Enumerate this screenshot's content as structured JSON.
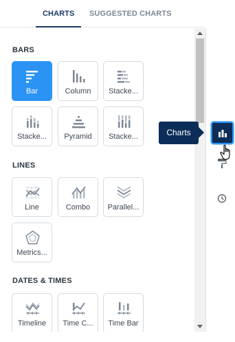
{
  "tabs": [
    {
      "label": "CHARTS",
      "active": true
    },
    {
      "label": "SUGGESTED CHARTS",
      "active": false
    }
  ],
  "sections": {
    "bars": {
      "title": "BARS",
      "items": [
        {
          "label": "Bar",
          "icon": "bar-chart-icon",
          "selected": true
        },
        {
          "label": "Column",
          "icon": "column-chart-icon"
        },
        {
          "label": "Stacke...",
          "icon": "stacked-bar-icon"
        },
        {
          "label": "Stacke...",
          "icon": "stacked-column-icon"
        },
        {
          "label": "Pyramid",
          "icon": "pyramid-chart-icon"
        },
        {
          "label": "Stacke...",
          "icon": "stacked-percent-icon"
        }
      ]
    },
    "lines": {
      "title": "LINES",
      "items": [
        {
          "label": "Line",
          "icon": "line-chart-icon"
        },
        {
          "label": "Combo",
          "icon": "combo-chart-icon"
        },
        {
          "label": "Parallel...",
          "icon": "parallel-chart-icon"
        },
        {
          "label": "Metrics...",
          "icon": "metrics-radar-icon"
        }
      ]
    },
    "dates": {
      "title": "DATES & TIMES",
      "items": [
        {
          "label": "Timeline",
          "icon": "timeline-chart-icon"
        },
        {
          "label": "Time C...",
          "icon": "time-combo-icon"
        },
        {
          "label": "Time Bar",
          "icon": "time-bar-icon"
        }
      ]
    }
  },
  "tooltip": {
    "text": "Charts"
  },
  "sidebar": {
    "charts_icon": "bar-chart-icon",
    "format_icon": "paint-roller-icon",
    "history_icon": "clock-icon"
  },
  "colors": {
    "accent": "#2b93f4",
    "navy": "#0c2d57",
    "tab_active": "#173a63"
  }
}
